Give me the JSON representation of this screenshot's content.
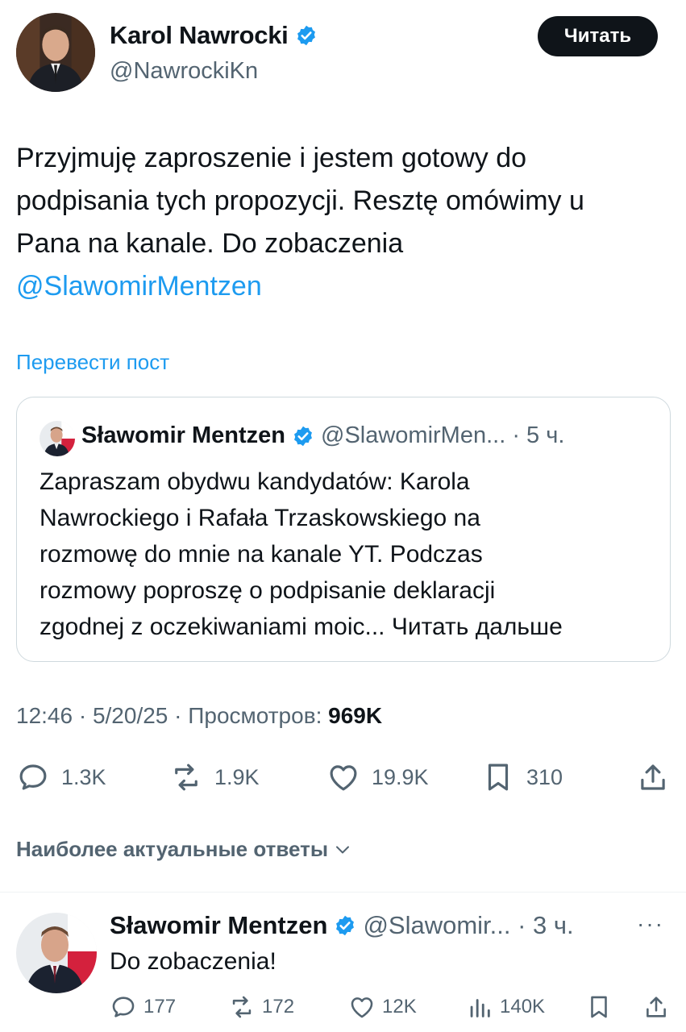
{
  "author": {
    "name": "Karol Nawrocki",
    "handle": "@NawrockiKn",
    "follow_label": "Читать"
  },
  "tweet": {
    "lines": [
      "Przyjmuję zaproszenie i jestem gotowy do",
      "podpisania tych propozycji. Resztę omówimy u",
      "Pana na kanale. Do zobaczenia"
    ],
    "mention": "@SlawomirMentzen",
    "translate_label": "Перевести пост"
  },
  "quote": {
    "name": "Sławomir Mentzen",
    "handle_time": "@SlawomirMen... · 5 ч.",
    "lines": [
      "Zapraszam obydwu kandydatów: Karola",
      "Nawrockiego i Rafała Trzaskowskiego na",
      "rozmowę do mnie na kanale YT. Podczas",
      "rozmowy poproszę o podpisanie deklaracji",
      "zgodnej z oczekiwaniami moic... Читать дальше"
    ]
  },
  "meta": {
    "time_date": "12:46 · 5/20/25 · Просмотров:",
    "views": "969K"
  },
  "actions": {
    "replies": "1.3K",
    "reposts": "1.9K",
    "likes": "19.9K",
    "bookmarks": "310"
  },
  "replies_sort_label": "Наиболее актуальные ответы",
  "reply": {
    "name": "Sławomir Mentzen",
    "handle_time": "@Slawomir... · 3 ч.",
    "more": "···",
    "text": "Do zobaczenia!",
    "replies": "177",
    "reposts": "172",
    "likes": "12K",
    "views": "140K"
  },
  "colors": {
    "accent": "#1d9bf0",
    "text": "#0f1419",
    "secondary": "#536471",
    "border": "#cfd9de"
  },
  "icons": [
    "verified-icon",
    "reply-icon",
    "repost-icon",
    "like-icon",
    "bookmark-icon",
    "share-icon",
    "views-icon",
    "chevron-down-icon",
    "more-icon"
  ]
}
